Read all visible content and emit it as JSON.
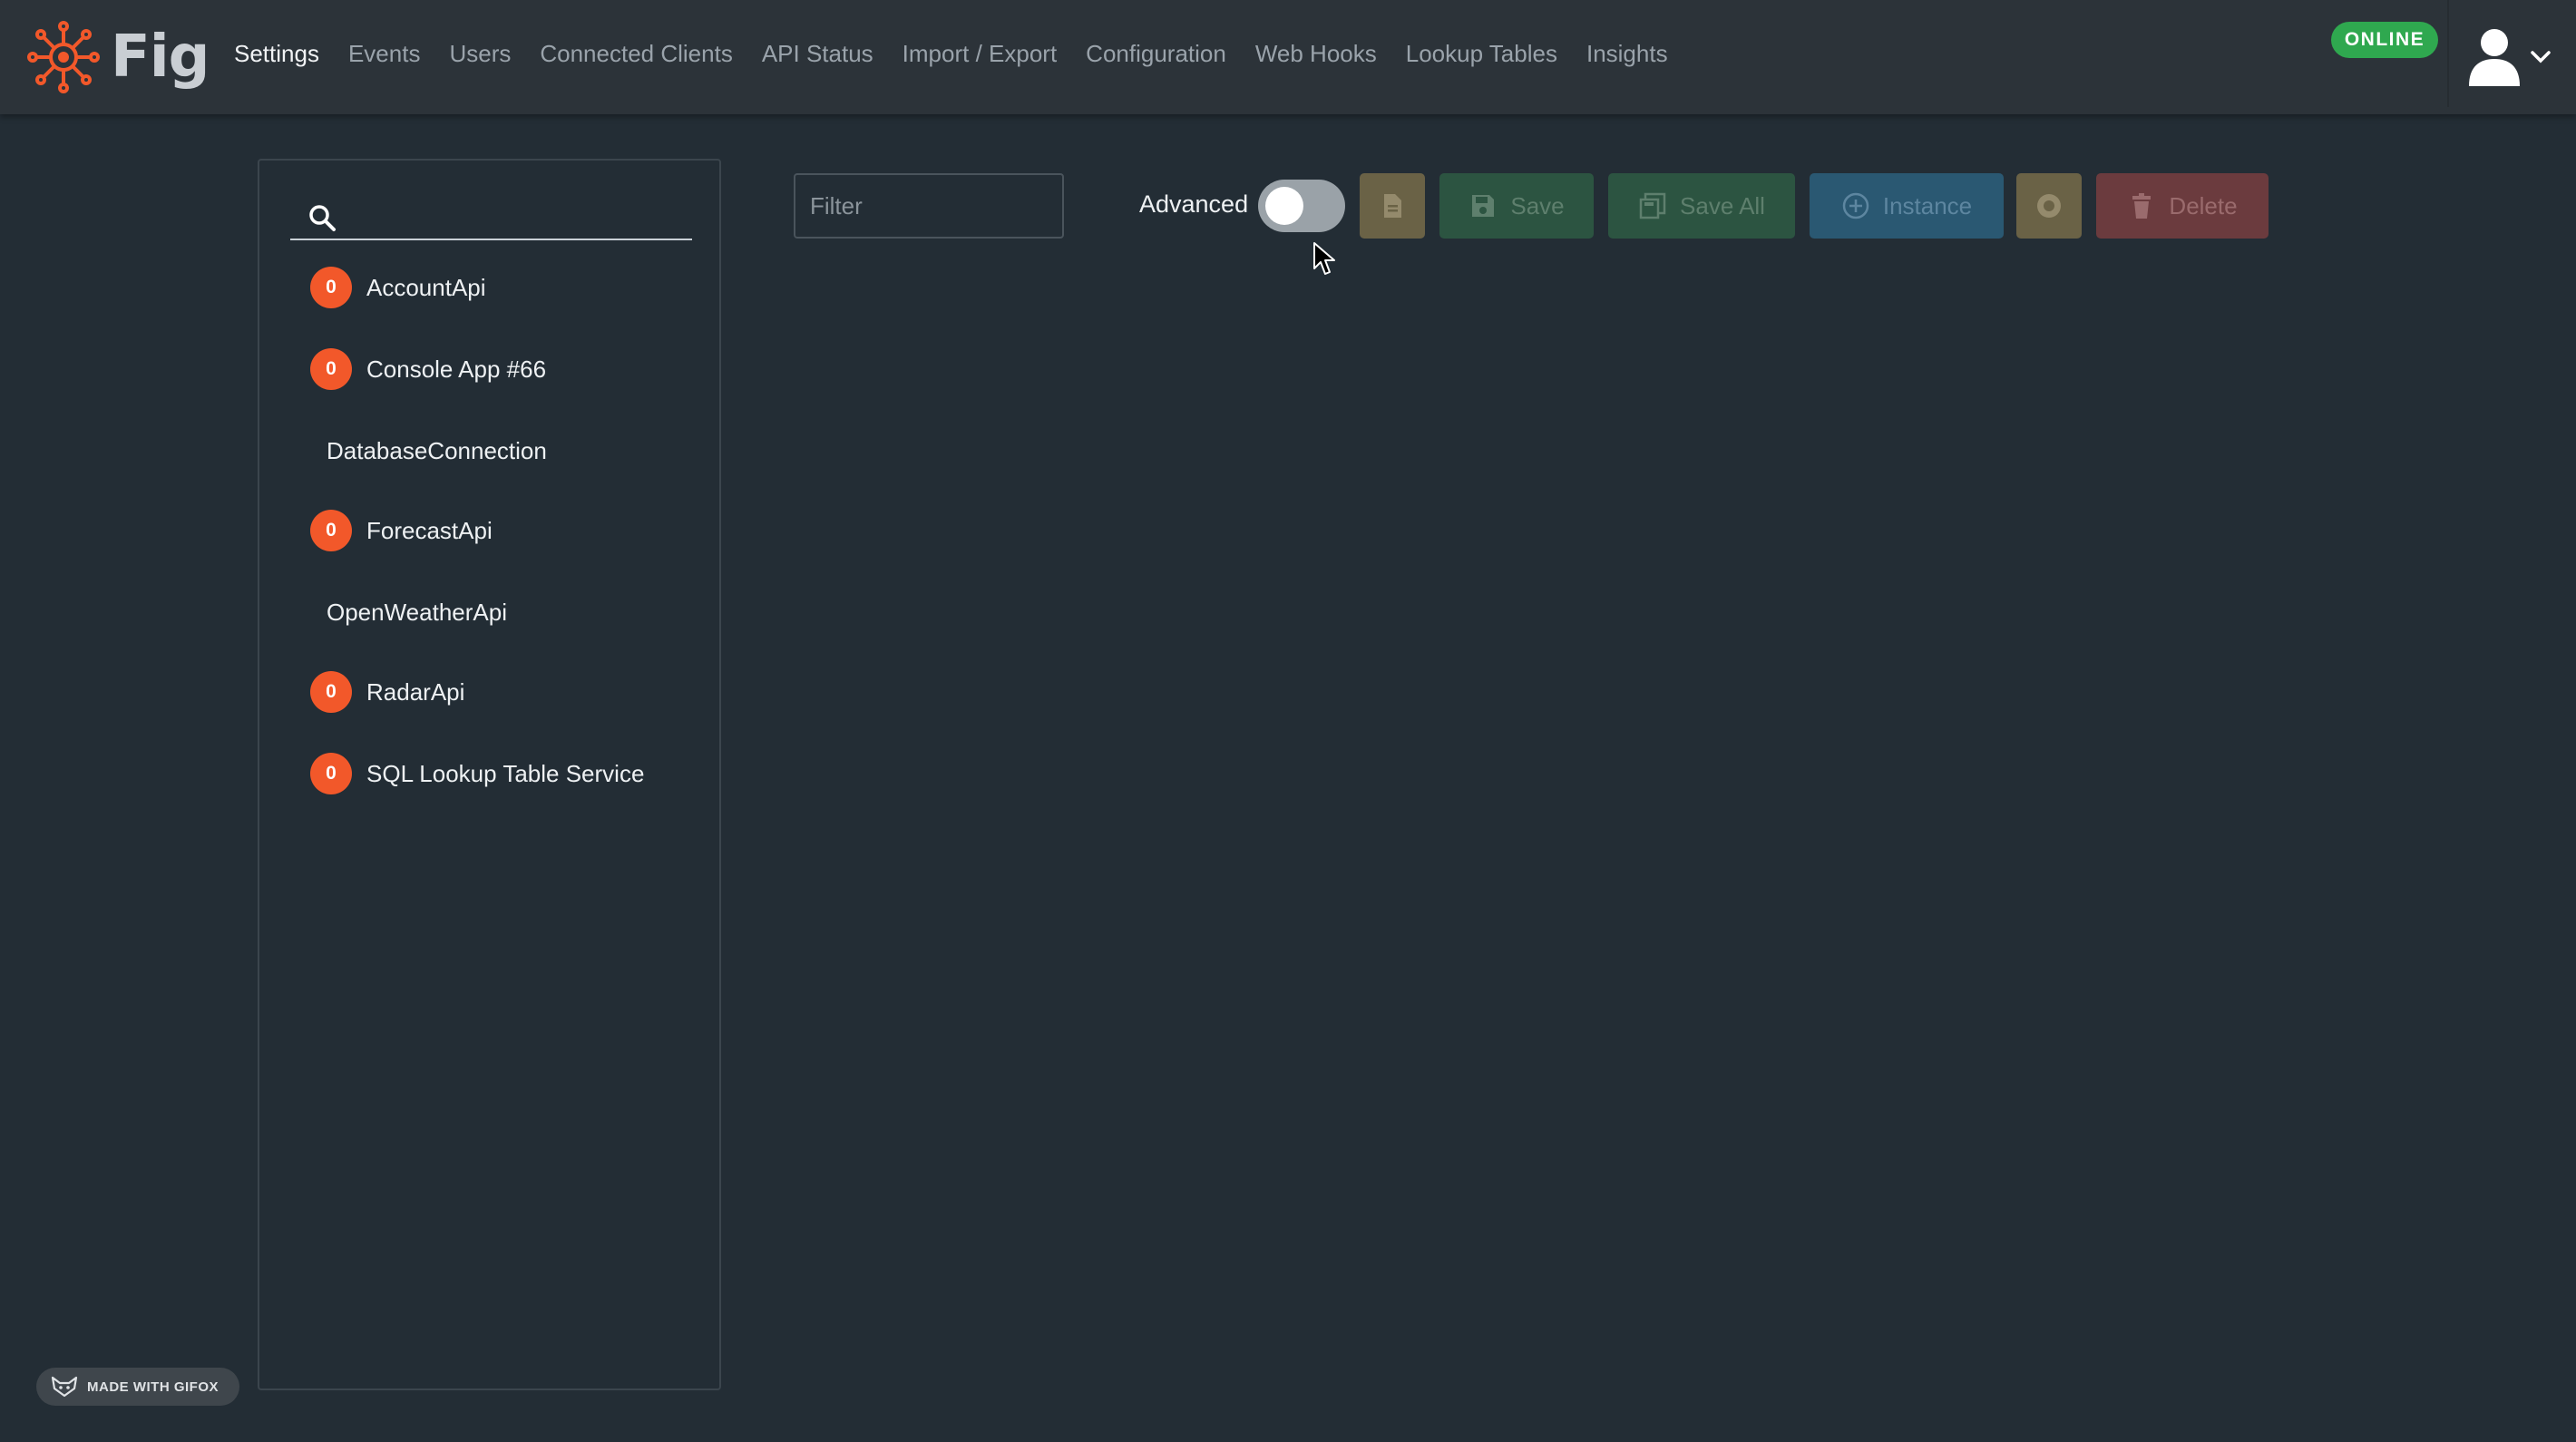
{
  "brand": {
    "name": "Fig",
    "accent": "#f2582a"
  },
  "nav": {
    "items": [
      {
        "label": "Settings",
        "active": true
      },
      {
        "label": "Events"
      },
      {
        "label": "Users"
      },
      {
        "label": "Connected Clients"
      },
      {
        "label": "API Status"
      },
      {
        "label": "Import / Export"
      },
      {
        "label": "Configuration"
      },
      {
        "label": "Web Hooks"
      },
      {
        "label": "Lookup Tables"
      },
      {
        "label": "Insights"
      }
    ],
    "status": "ONLINE",
    "status_color": "#2fa84f",
    "user_icon": "user-icon"
  },
  "sidebar": {
    "search_placeholder": "",
    "clients": [
      {
        "name": "AccountApi",
        "badge": "0"
      },
      {
        "name": "Console App #66",
        "badge": "0"
      },
      {
        "name": "DatabaseConnection",
        "badge": null
      },
      {
        "name": "ForecastApi",
        "badge": "0"
      },
      {
        "name": "OpenWeatherApi",
        "badge": null
      },
      {
        "name": "RadarApi",
        "badge": "0"
      },
      {
        "name": "SQL Lookup Table Service",
        "badge": "0"
      }
    ]
  },
  "toolbar": {
    "filter_placeholder": "Filter",
    "advanced_label": "Advanced",
    "advanced_enabled": false,
    "save_label": "Save",
    "save_all_label": "Save All",
    "instance_label": "Instance",
    "delete_label": "Delete"
  },
  "watermark": {
    "text": "MADE WITH GIFOX"
  }
}
